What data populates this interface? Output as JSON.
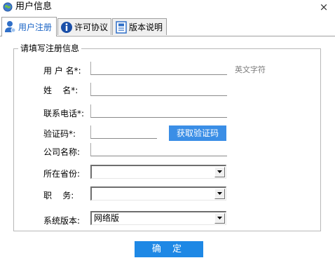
{
  "window": {
    "title": "用户信息",
    "close_glyph": "×"
  },
  "tabs": [
    {
      "label": "用户注册",
      "icon": "user-icon",
      "active": true
    },
    {
      "label": "许可协议",
      "icon": "info-icon",
      "active": false
    },
    {
      "label": "版本说明",
      "icon": "document-icon",
      "active": false
    }
  ],
  "form": {
    "group_title": "请填写注册信息",
    "username": {
      "label": "用 户 名*:",
      "value": "",
      "hint": "英文字符"
    },
    "name": {
      "label": "姓    名*:",
      "value": ""
    },
    "phone": {
      "label": "联系电话*:",
      "value": ""
    },
    "captcha": {
      "label": "验证码*:",
      "value": "",
      "button": "获取验证码"
    },
    "company": {
      "label": "公司名称:",
      "value": ""
    },
    "province": {
      "label": "所在省份:",
      "value": ""
    },
    "position": {
      "label": "职    务:",
      "value": ""
    },
    "version": {
      "label": "系统版本:",
      "value": "网络版"
    }
  },
  "actions": {
    "ok": "确 定"
  },
  "colors": {
    "accent": "#1e88e5",
    "button_blue": "#3a8ee6",
    "active_tab_text": "#1a64c6"
  }
}
